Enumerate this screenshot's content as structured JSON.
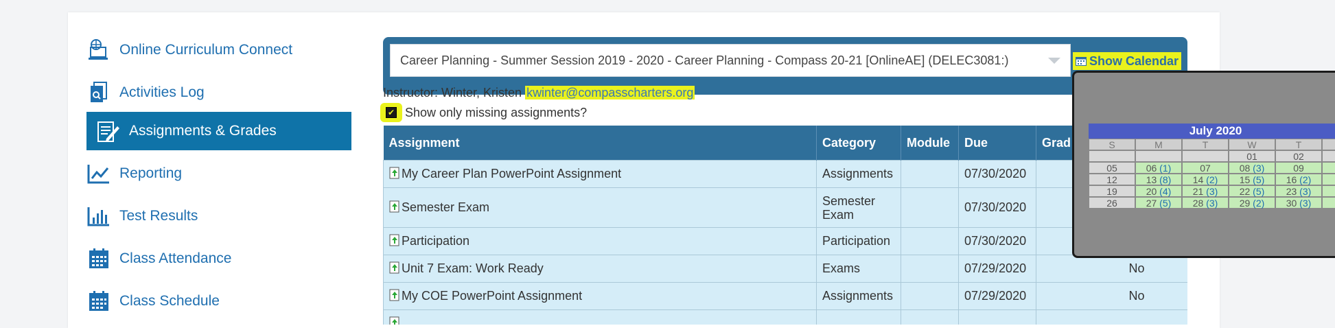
{
  "sidebar": {
    "items": [
      {
        "label": "Online Curriculum Connect",
        "icon": "computer-curriculum-icon"
      },
      {
        "label": "Activities Log",
        "icon": "activities-log-icon"
      },
      {
        "label": "Assignments & Grades",
        "icon": "assignments-grades-icon",
        "active": true
      },
      {
        "label": "Reporting",
        "icon": "line-chart-icon"
      },
      {
        "label": "Test Results",
        "icon": "bar-chart-icon"
      },
      {
        "label": "Class Attendance",
        "icon": "calendar-grid-icon"
      },
      {
        "label": "Class Schedule",
        "icon": "calendar-grid-icon"
      }
    ]
  },
  "header": {
    "course": "Career Planning - Summer Session 2019 - 2020 - Career Planning - Compass 20-21 [OnlineAE] (DELEC3081:)",
    "show_calendar": "Show Calendar",
    "instructor_prefix": "Instructor: Winter, Kristen ",
    "instructor_email": "kwinter@compasscharters.org",
    "missing_label": "Show only missing assignments?"
  },
  "table": {
    "headers": [
      "Assignment",
      "Category",
      "Module",
      "Due",
      "Grad"
    ],
    "rows": [
      {
        "assignment": "My Career Plan PowerPoint Assignment",
        "category": "Assignments",
        "due": "07/30/2020",
        "status": ""
      },
      {
        "assignment": "Semester Exam",
        "category": "Semester Exam",
        "due": "07/30/2020",
        "status": ""
      },
      {
        "assignment": "Participation",
        "category": "Participation",
        "due": "07/30/2020",
        "status": ""
      },
      {
        "assignment": "Unit 7 Exam: Work Ready",
        "category": "Exams",
        "due": "07/29/2020",
        "status": "No"
      },
      {
        "assignment": "My COE PowerPoint Assignment",
        "category": "Assignments",
        "due": "07/29/2020",
        "status": "No"
      },
      {
        "assignment": "",
        "category": "",
        "due": "",
        "status": ""
      }
    ]
  },
  "calendar": {
    "title": "July 2020",
    "days": [
      "S",
      "M",
      "T",
      "W",
      "T"
    ],
    "weeks": [
      [
        "",
        "",
        "",
        "01",
        "02"
      ],
      [
        "05",
        "06 (1)",
        "07",
        "08 (3)",
        "09"
      ],
      [
        "12",
        "13 (8)",
        "14 (2)",
        "15 (5)",
        "16 (2)"
      ],
      [
        "19",
        "20 (4)",
        "21 (3)",
        "22 (5)",
        "23 (3)"
      ],
      [
        "26",
        "27 (5)",
        "28 (3)",
        "29 (2)",
        "30 (3)"
      ]
    ]
  },
  "colors": {
    "highlight": "#eaf21d",
    "header_blue": "#2f6f9a",
    "active_nav": "#0f73a8",
    "row_bg": "#d5edf8"
  }
}
